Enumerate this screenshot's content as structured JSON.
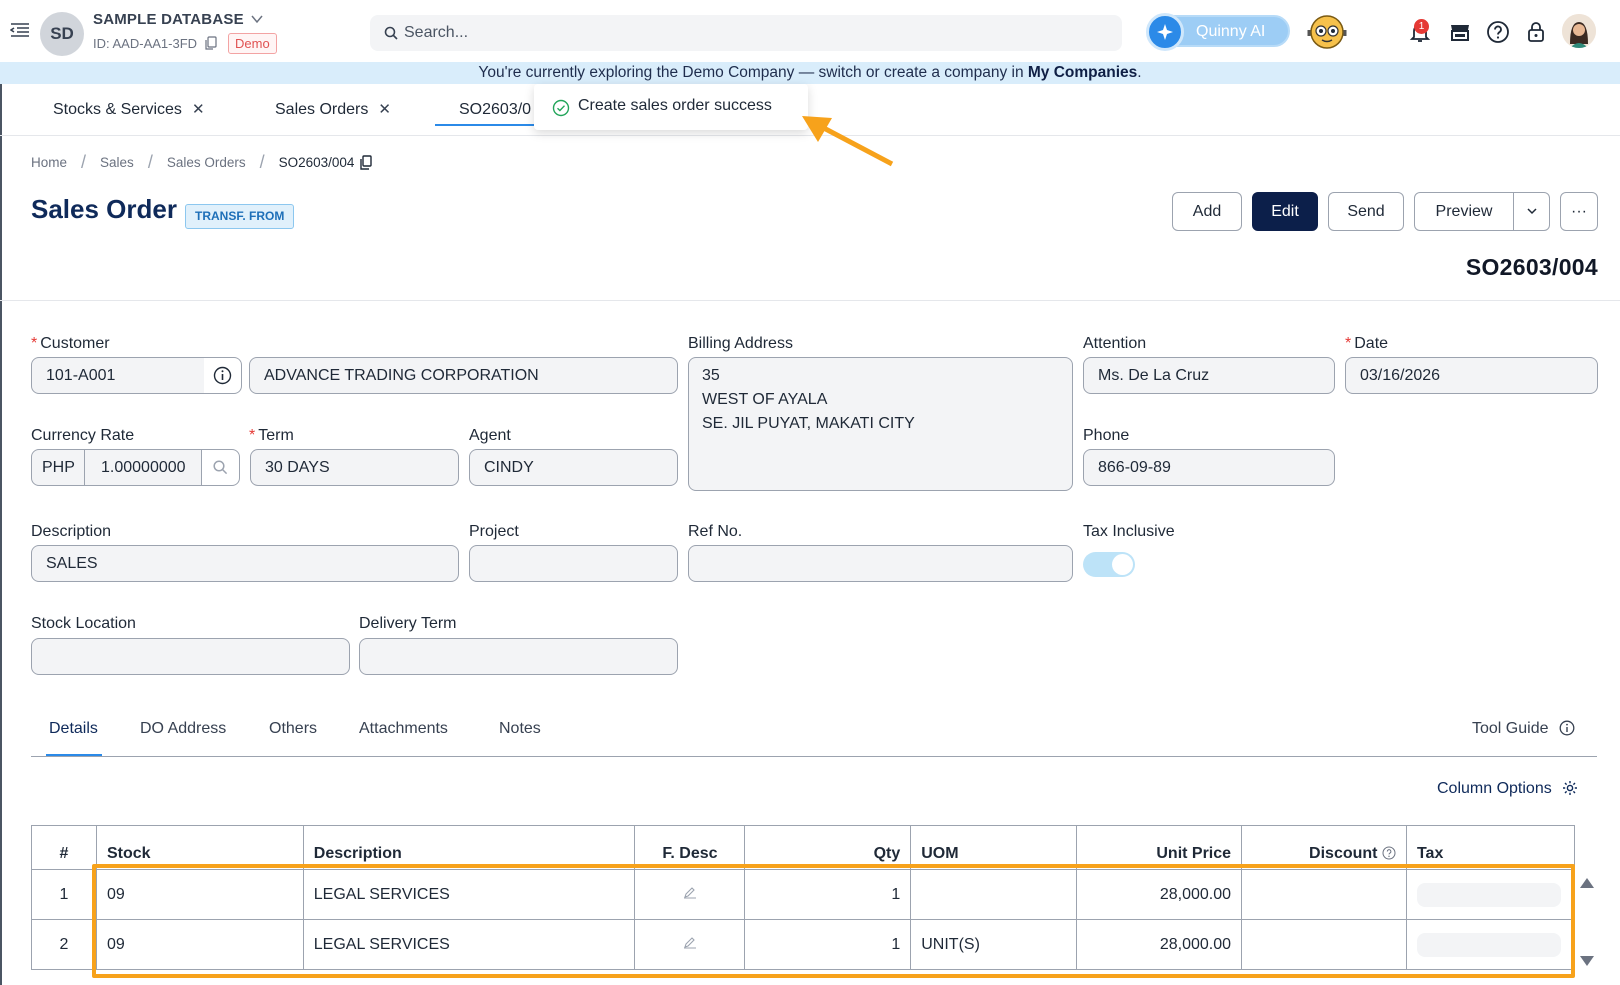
{
  "topbar": {
    "avatar_initials": "SD",
    "database_name": "SAMPLE DATABASE",
    "database_id": "ID: AAD-AA1-3FD",
    "demo_badge": "Demo",
    "search_placeholder": "Search...",
    "assistant_label": "Quinny AI",
    "notification_count": "1"
  },
  "banner": {
    "text_before": "You're currently exploring the Demo Company — switch or create a company in ",
    "link": "My Companies",
    "text_after": "."
  },
  "tabs": [
    {
      "label": "Stocks & Services",
      "closable": true
    },
    {
      "label": "Sales Orders",
      "closable": true
    },
    {
      "label": "SO2603/0",
      "active": true
    }
  ],
  "toast": {
    "message": "Create sales order success"
  },
  "breadcrumb": [
    "Home",
    "Sales",
    "Sales Orders",
    "SO2603/004"
  ],
  "page": {
    "title": "Sales Order",
    "badge": "TRANSF. FROM",
    "document_number": "SO2603/004"
  },
  "actions": {
    "add": "Add",
    "edit": "Edit",
    "send": "Send",
    "preview": "Preview",
    "more": "···"
  },
  "form": {
    "customer_label": "Customer",
    "customer_code": "101-A001",
    "customer_name": "ADVANCE TRADING CORPORATION",
    "billing_label": "Billing Address",
    "billing_address": "35\nWEST OF AYALA\nSE. JIL PUYAT, MAKATI CITY",
    "attention_label": "Attention",
    "attention": "Ms. De La Cruz",
    "date_label": "Date",
    "date": "03/16/2026",
    "currency_label": "Currency Rate",
    "currency": "PHP",
    "rate": "1.00000000",
    "term_label": "Term",
    "term": "30 DAYS",
    "agent_label": "Agent",
    "agent": "CINDY",
    "phone_label": "Phone",
    "phone": "866-09-89",
    "description_label": "Description",
    "description": "SALES",
    "project_label": "Project",
    "project": "",
    "ref_label": "Ref No.",
    "ref_no": "",
    "tax_inclusive_label": "Tax Inclusive",
    "tax_inclusive": true,
    "stock_location_label": "Stock Location",
    "stock_location": "",
    "delivery_term_label": "Delivery Term",
    "delivery_term": ""
  },
  "detail_tabs": [
    "Details",
    "DO Address",
    "Others",
    "Attachments",
    "Notes"
  ],
  "tool_guide": "Tool Guide",
  "column_options": "Column Options",
  "table": {
    "headers": [
      "#",
      "Stock",
      "Description",
      "F. Desc",
      "Qty",
      "UOM",
      "Unit Price",
      "Discount",
      "Tax"
    ],
    "rows": [
      {
        "no": "1",
        "stock": "09",
        "description": "LEGAL SERVICES",
        "qty": "1",
        "uom": "",
        "unit_price": "28,000.00",
        "discount": "",
        "tax": ""
      },
      {
        "no": "2",
        "stock": "09",
        "description": "LEGAL SERVICES",
        "qty": "1",
        "uom": "UNIT(S)",
        "unit_price": "28,000.00",
        "discount": "",
        "tax": ""
      }
    ]
  },
  "colors": {
    "primary": "#0c1f4a",
    "accent": "#2b8ae8",
    "highlight": "#f7a21b",
    "required": "#e53935"
  }
}
